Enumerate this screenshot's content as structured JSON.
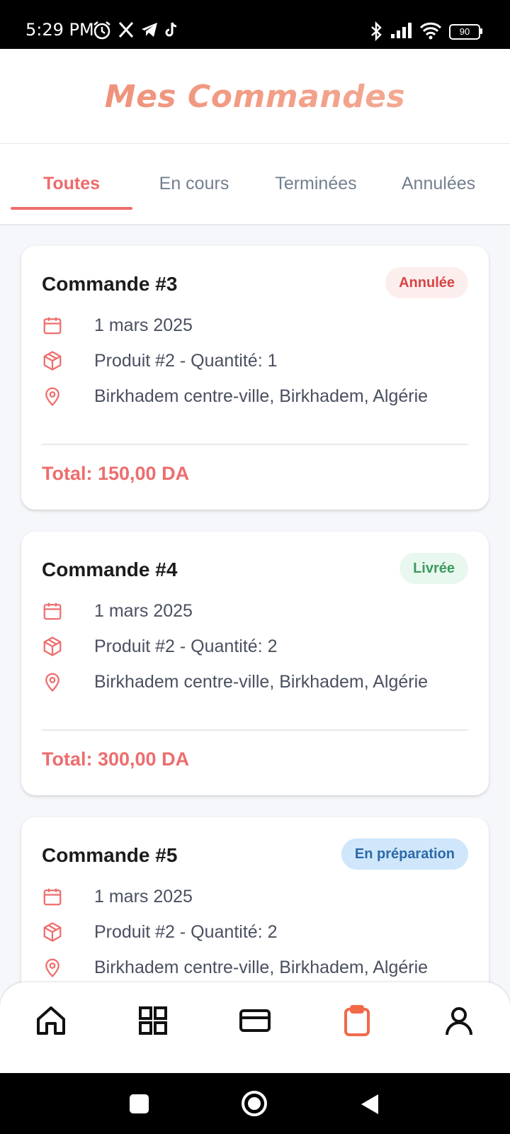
{
  "status_bar": {
    "time": "5:29 PM",
    "battery": "90"
  },
  "app_title": "Mes Commandes",
  "tabs": [
    {
      "label": "Toutes",
      "active": true
    },
    {
      "label": "En cours",
      "active": false
    },
    {
      "label": "Terminées",
      "active": false
    },
    {
      "label": "Annulées",
      "active": false
    }
  ],
  "orders": [
    {
      "title": "Commande #3",
      "status": "Annulée",
      "date": "1 mars 2025",
      "product": "Produit #2 - Quantité: 1",
      "address": "Birkhadem centre-ville, Birkhadem, Algérie",
      "total": "Total: 150,00 DA"
    },
    {
      "title": "Commande #4",
      "status": "Livrée",
      "date": "1 mars 2025",
      "product": "Produit #2 - Quantité: 2",
      "address": "Birkhadem centre-ville, Birkhadem, Algérie",
      "total": "Total: 300,00 DA"
    },
    {
      "title": "Commande #5",
      "status": "En préparation",
      "date": "1 mars 2025",
      "product": "Produit #2 - Quantité: 2",
      "address": "Birkhadem centre-ville, Birkhadem, Algérie",
      "total": ""
    }
  ],
  "status_colors": {
    "Annulée": {
      "bg": "#fdeeee",
      "fg": "#d64545"
    },
    "Livrée": {
      "bg": "#e9f8ef",
      "fg": "#3c9a5f"
    },
    "En préparation": {
      "bg": "#cfe6fb",
      "fg": "#2c6aa8"
    }
  },
  "bottom_nav": [
    {
      "icon": "home-icon",
      "active": false
    },
    {
      "icon": "grid-icon",
      "active": false
    },
    {
      "icon": "card-icon",
      "active": false
    },
    {
      "icon": "clipboard-icon",
      "active": true
    },
    {
      "icon": "user-icon",
      "active": false
    }
  ],
  "accent_color": "#ee6d6d"
}
